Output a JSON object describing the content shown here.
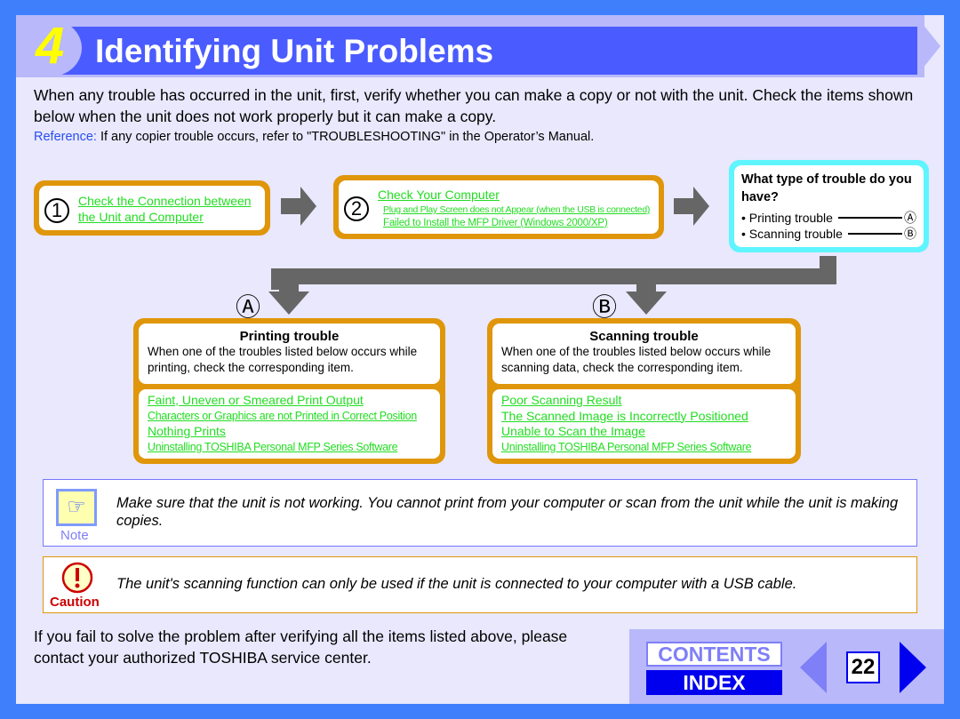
{
  "header": {
    "number": "4",
    "title": "Identifying Unit Problems"
  },
  "intro": "When any trouble has occurred in the unit, first, verify whether you can make a copy or not with the unit. Check the items shown below when the unit does not work properly but it can make a copy.",
  "reference": {
    "label": "Reference:",
    "text": " If any copier trouble occurs, refer to \"TROUBLESHOOTING\" in the Operator’s Manual."
  },
  "step1": {
    "num": "1",
    "line1": "Check the Connection between",
    "line2": "the Unit and Computer"
  },
  "step2": {
    "num": "2",
    "title": "Check Your Computer",
    "items": [
      "Plug and Play Screen does not Appear (when the USB is connected)",
      "Failed to Install the MFP Driver (Windows 2000/XP)"
    ]
  },
  "question": {
    "title": "What type of trouble do you have?",
    "options": [
      {
        "label": "• Printing trouble",
        "target": "Ⓐ"
      },
      {
        "label": "• Scanning trouble",
        "target": "Ⓑ"
      }
    ]
  },
  "branchA": {
    "marker": "Ⓐ",
    "title": "Printing trouble",
    "desc": "When one of the troubles listed below occurs while printing, check the corresponding item.",
    "links": [
      "Faint, Uneven or Smeared Print Output",
      "Characters or Graphics are not Printed in Correct Position",
      "Nothing Prints",
      "Uninstalling TOSHIBA Personal MFP Series Software"
    ]
  },
  "branchB": {
    "marker": "Ⓑ",
    "title": "Scanning trouble",
    "desc": "When one of the troubles listed below occurs while scanning data, check the corresponding item.",
    "links": [
      "Poor Scanning Result",
      "The Scanned Image is Incorrectly Positioned",
      "Unable to Scan the Image",
      "Uninstalling TOSHIBA Personal MFP Series Software"
    ]
  },
  "note": {
    "label": "Note",
    "text": "Make sure that the unit is not working. You cannot print from your computer or scan from the unit while the unit is making copies."
  },
  "caution": {
    "label": "Caution",
    "text": "The unit's scanning function can only be used if the unit is connected to your computer with a USB cable."
  },
  "footer": {
    "text": "If you fail to solve the problem after verifying all the items listed above, please contact your authorized TOSHIBA service center."
  },
  "nav": {
    "contents": "CONTENTS",
    "index": "INDEX",
    "page": "22"
  },
  "colors": {
    "background": "#3f7ffc",
    "panel": "#e9e8fd",
    "header": "#4a5cff",
    "link": "#22dd22",
    "orange": "#e0960a",
    "cyan": "#5ff5ff"
  }
}
